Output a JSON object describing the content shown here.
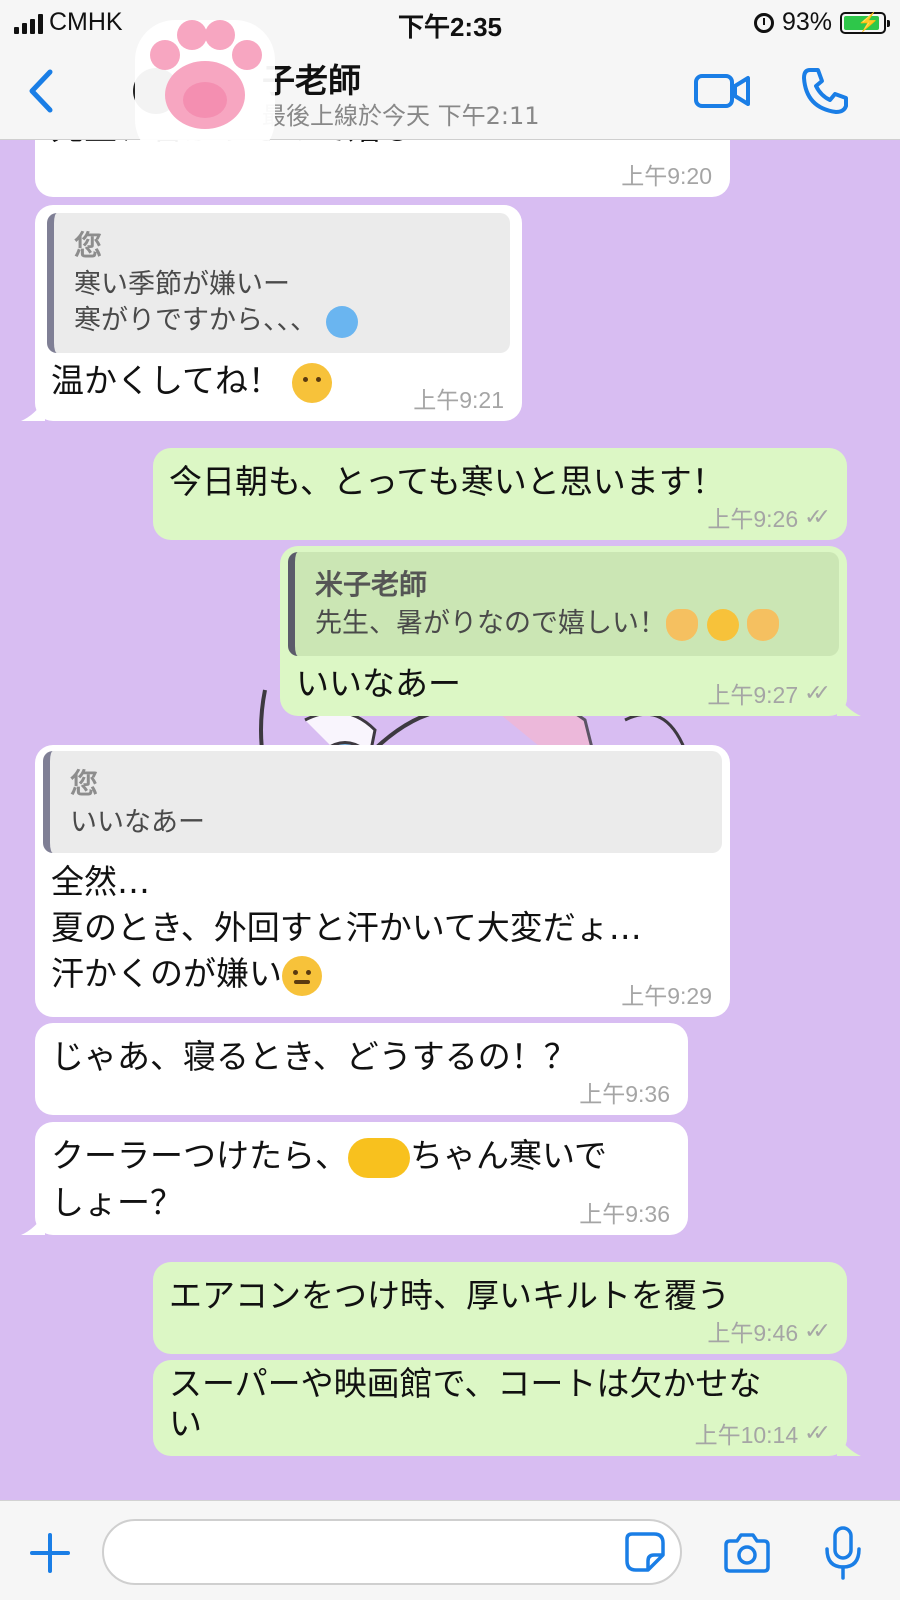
{
  "status_bar": {
    "carrier": "CMHK",
    "time": "下午2:35",
    "battery": "93%",
    "battery_level": 0.93
  },
  "header": {
    "contact_name": "子老師",
    "last_seen": "最後上線於今天 下午2:11"
  },
  "messages": [
    {
      "direction": "in",
      "text": "先生、暑がりなので嬉しい！",
      "time": "上午9:20"
    },
    {
      "direction": "in",
      "quote_author": "您",
      "quote_text": "寒い季節が嫌いー\n寒がりですから、、、",
      "text": "温かくしてね！",
      "time": "上午9:21"
    },
    {
      "direction": "out",
      "text": "今日朝も、とっても寒いと思います！",
      "time": "上午9:26"
    },
    {
      "direction": "out",
      "quote_author": "米子老師",
      "quote_text": "先生、暑がりなので嬉しい！",
      "text": "いいなあー",
      "time": "上午9:27"
    },
    {
      "direction": "in",
      "quote_author": "您",
      "quote_text": "いいなあー",
      "text": "全然…\n夏のとき、外回すと汗かいて大変だょ…\n汗かくのが嫌い",
      "time": "上午9:29"
    },
    {
      "direction": "in",
      "text": "じゃあ、寝るとき、どうするの！？",
      "time": "上午9:36"
    },
    {
      "direction": "in",
      "text_before": "クーラーつけたら、",
      "text_after": "ちゃん寒いで\nしょー？",
      "time": "上午9:36"
    },
    {
      "direction": "out",
      "text": "エアコンをつけ時、厚いキルトを覆う",
      "time": "上午9:46"
    },
    {
      "direction": "out",
      "text": "スーパーや映画館で、コートは欠かせな\nい",
      "time": "上午10:14"
    }
  ],
  "input": {
    "placeholder": ""
  },
  "colors": {
    "accent": "#1a7ee6",
    "outgoing_bubble": "#dcf7c5",
    "incoming_bubble": "#ffffff",
    "chat_background": "#d8bdf2"
  },
  "icons": [
    "back-icon",
    "video-call-icon",
    "phone-call-icon",
    "plus-icon",
    "sticker-icon",
    "camera-icon",
    "microphone-icon",
    "read-ticks-icon"
  ]
}
